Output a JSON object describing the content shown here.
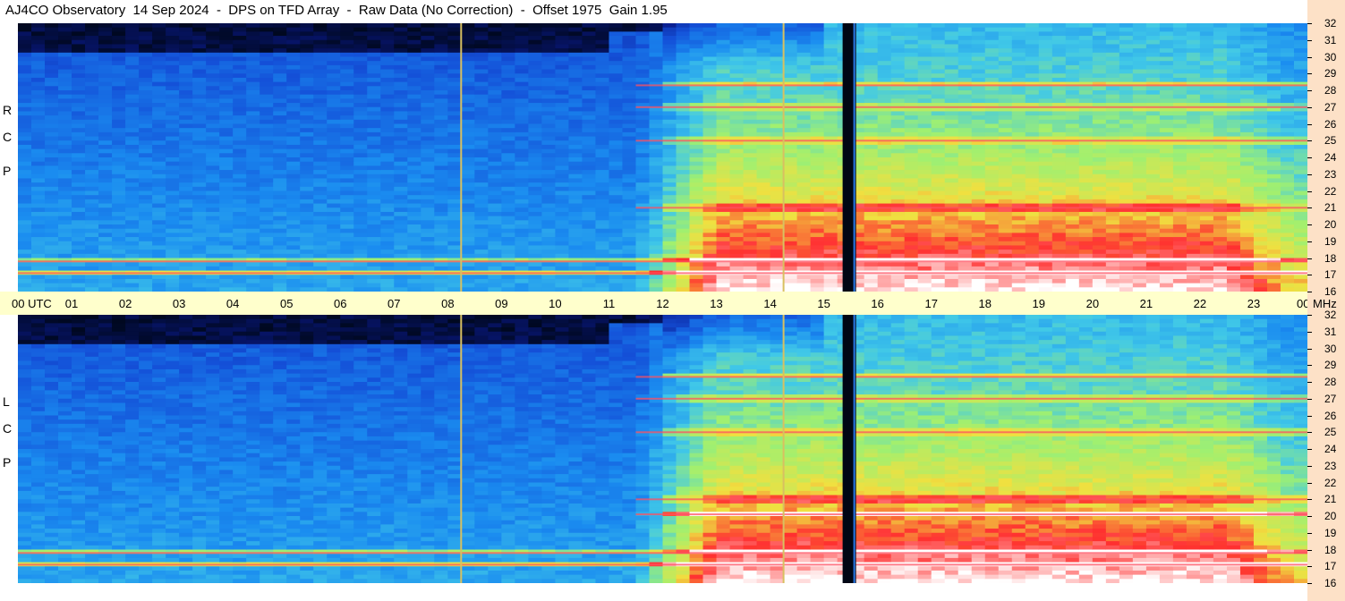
{
  "title": "AJ4CO Observatory  14 Sep 2024  -  DPS on TFD Array  -  Raw Data (No Correction)  -  Offset 1975  Gain 1.95",
  "chart_data": [
    {
      "type": "heatmap",
      "panel": "RCP",
      "label_letters": [
        "R",
        "C",
        "P"
      ],
      "x_ticks": [
        "00 UTC",
        "01",
        "02",
        "03",
        "04",
        "05",
        "06",
        "07",
        "08",
        "09",
        "10",
        "11",
        "12",
        "13",
        "14",
        "15",
        "16",
        "17",
        "18",
        "19",
        "20",
        "21",
        "22",
        "23",
        "00"
      ],
      "xlim": [
        0,
        24
      ],
      "y_ticks": [
        "16",
        "17",
        "18",
        "19",
        "20",
        "21",
        "22",
        "23",
        "24",
        "25",
        "26",
        "27",
        "28",
        "29",
        "30",
        "31",
        "32"
      ],
      "ylim": [
        16,
        32
      ],
      "y_unit": "MHz",
      "colormap": [
        "#000820",
        "#0a1a8a",
        "#1450d8",
        "#1a8cf0",
        "#40c8e8",
        "#a0f070",
        "#f0e040",
        "#ff3030",
        "#ffffff"
      ],
      "vertical_markers_utc": [
        8.25,
        14.25
      ],
      "bright_bands_mhz": [
        17.1,
        17.8,
        21.0,
        25.0,
        27.0,
        28.3
      ],
      "dark_gap_utc": [
        15.35,
        15.6
      ]
    },
    {
      "type": "heatmap",
      "panel": "LCP",
      "label_letters": [
        "L",
        "C",
        "P"
      ],
      "x_ticks": [
        "00 UTC",
        "01",
        "02",
        "03",
        "04",
        "05",
        "06",
        "07",
        "08",
        "09",
        "10",
        "11",
        "12",
        "13",
        "14",
        "15",
        "16",
        "17",
        "18",
        "19",
        "20",
        "21",
        "22",
        "23",
        "00"
      ],
      "xlim": [
        0,
        24
      ],
      "y_ticks": [
        "16",
        "17",
        "18",
        "19",
        "20",
        "21",
        "22",
        "23",
        "24",
        "25",
        "26",
        "27",
        "28",
        "29",
        "30",
        "31",
        "32"
      ],
      "ylim": [
        16,
        32
      ],
      "y_unit": "MHz",
      "colormap": [
        "#000820",
        "#0a1a8a",
        "#1450d8",
        "#1a8cf0",
        "#40c8e8",
        "#a0f070",
        "#f0e040",
        "#ff3030",
        "#ffffff"
      ],
      "vertical_markers_utc": [
        8.25,
        14.25
      ],
      "bright_bands_mhz": [
        17.1,
        17.8,
        20.1,
        21.0,
        25.0,
        27.0,
        28.3
      ],
      "dark_gap_utc": [
        15.35,
        15.6
      ]
    }
  ],
  "x_axis_unit_label": "MHz"
}
